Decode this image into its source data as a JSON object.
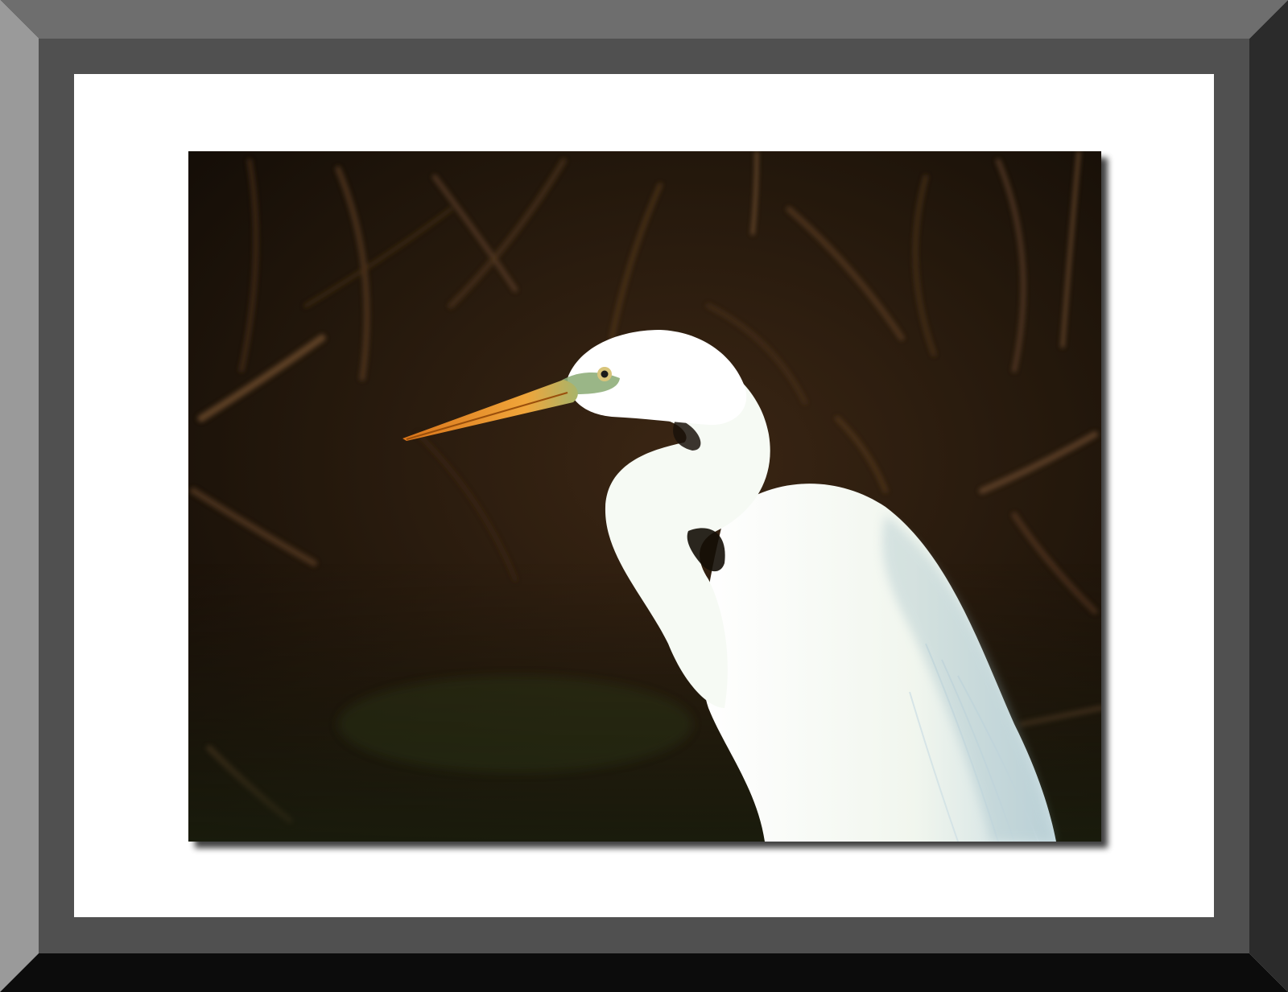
{
  "image": {
    "subject": "great-egret",
    "colors": {
      "frame_top": "#6e6e6e",
      "frame_left": "#999999",
      "frame_right": "#2b2b2b",
      "frame_bottom": "#0c0c0c",
      "frame_inner_band": "#505050",
      "mat": "#ffffff",
      "background_dark": "#1a120a",
      "background_brown": "#3b2614",
      "branch_light": "#6b4a2d",
      "egret_white": "#f4f8f2",
      "egret_shadow": "#bcd3d6",
      "beak_orange": "#e08a1e",
      "lore_green": "#8fae7a"
    }
  }
}
